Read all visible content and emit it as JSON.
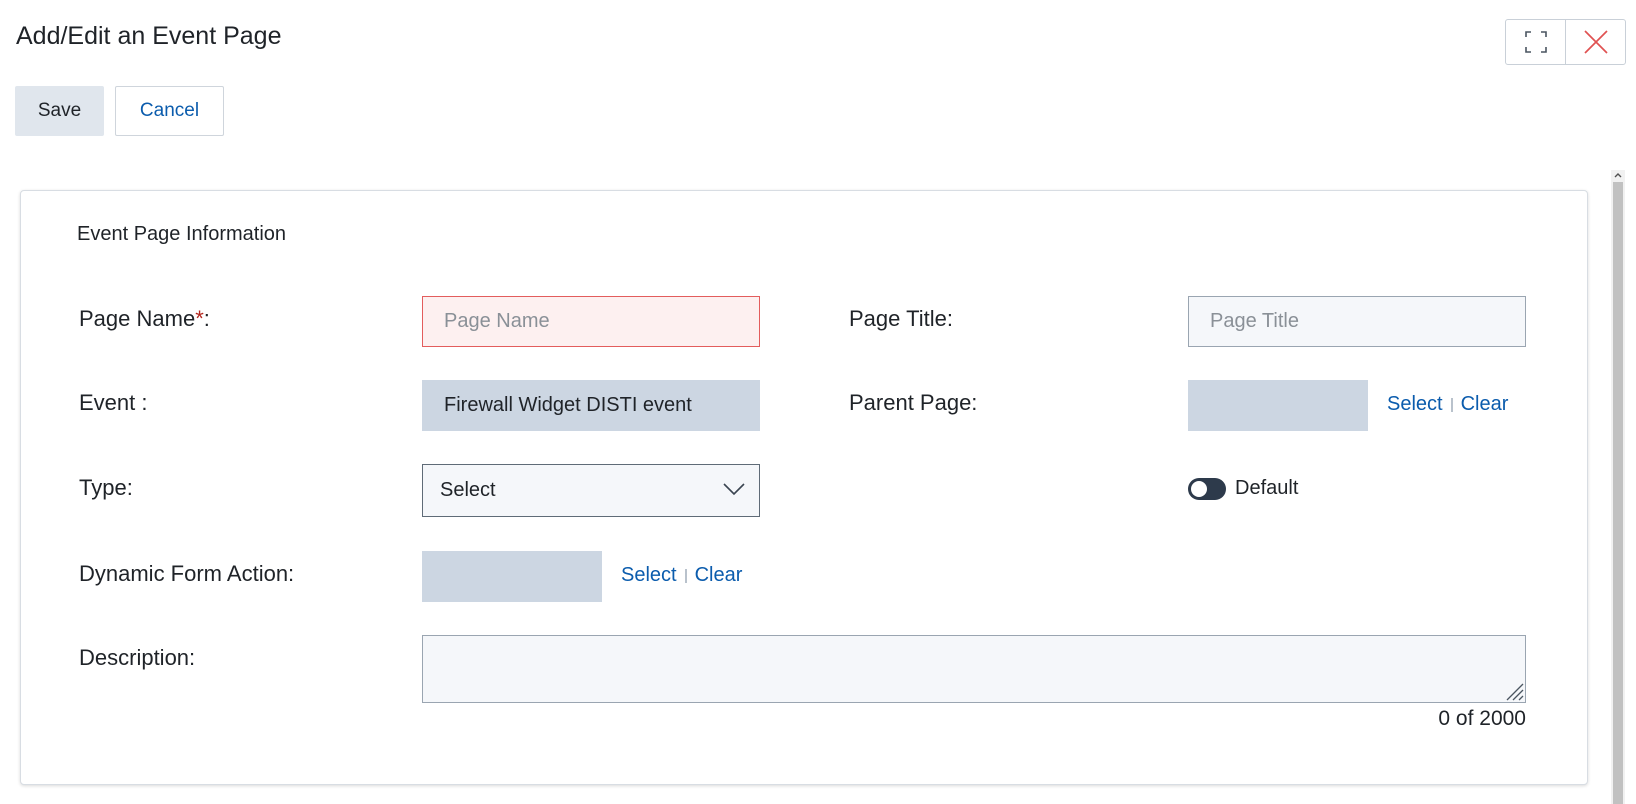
{
  "dialog": {
    "title": "Add/Edit an Event Page",
    "icons": {
      "maximize": "maximize-icon",
      "close": "close-icon"
    }
  },
  "toolbar": {
    "save_label": "Save",
    "cancel_label": "Cancel"
  },
  "section": {
    "title": "Event Page Information"
  },
  "form": {
    "page_name": {
      "label": "Page Name",
      "required_mark": "*",
      "suffix": ":",
      "value": "",
      "placeholder": "Page Name"
    },
    "page_title": {
      "label": "Page Title:",
      "value": "",
      "placeholder": "Page Title"
    },
    "event": {
      "label": "Event :",
      "value": "Firewall Widget DISTI event"
    },
    "parent_page": {
      "label": "Parent Page:",
      "value": "",
      "select_label": "Select",
      "clear_label": "Clear"
    },
    "type": {
      "label": "Type:",
      "selected": "Select"
    },
    "default_toggle": {
      "label": "Default",
      "checked": false
    },
    "dynamic_form_action": {
      "label": "Dynamic Form Action:",
      "value": "",
      "select_label": "Select",
      "clear_label": "Clear"
    },
    "description": {
      "label": "Description:",
      "value": "",
      "counter": "0 of 2000"
    }
  },
  "colors": {
    "link": "#0b5cad",
    "required": "#b3261e",
    "close_icon": "#e05252",
    "readonly_field": "#ccd6e2",
    "toggle_off": "#2d3a4b"
  }
}
